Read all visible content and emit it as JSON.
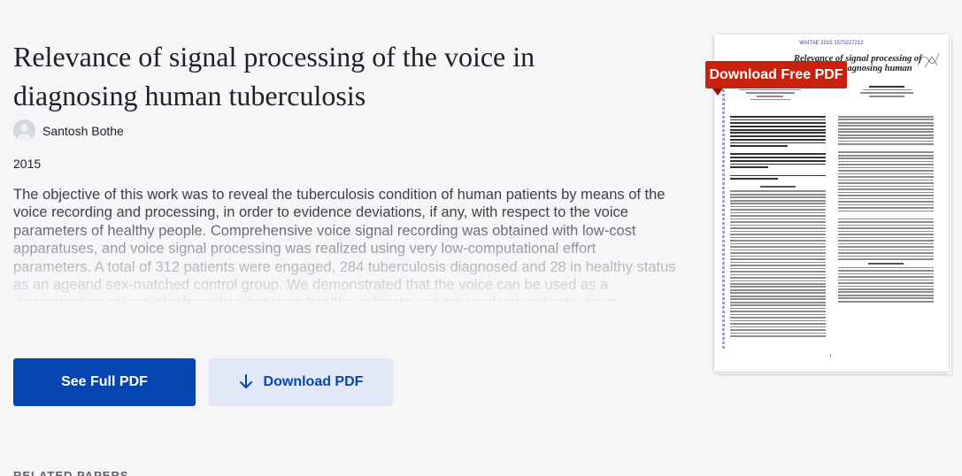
{
  "paper": {
    "title": "Relevance of signal processing of the voice in diagnosing human tuberculosis",
    "author": "Santosh Bothe",
    "year": "2015",
    "abstract": "The objective of this work was to reveal the tuberculosis condition of human patients by means of the voice recording and processing, in order to evidence deviations, if any, with respect to the voice parameters of healthy people. Comprehensive voice signal recording was obtained with low-cost apparatuses, and voice signal processing was realized using very low-computational effort parameters. A total of 312 patients were engaged, 284 tuberculosis diagnosed and 28 in healthy status as an ageand sex-matched control group. We demonstrated that the voice can be used as a discriminating source of information between healthy subjects and tuberculosis patients, since evidence of alterations founded in some of the voice features. Keywords— human voice; voice analysis; voice signal processing; tuberculosis"
  },
  "actions": {
    "see_full_pdf": "See Full PDF",
    "download_pdf": "Download PDF",
    "download_free_pdf": "Download Free PDF"
  },
  "preview": {
    "header": "WAITAE 2015 1570227212",
    "title": "Relevance of signal processing of the voice in diagnosing human tuberculosis",
    "page_number": "1"
  },
  "related_section": {
    "heading": "RELATED PAPERS"
  },
  "colors": {
    "primary": "#0645b1",
    "secondary_bg": "#e2e8f5",
    "badge_red": "#c8210e",
    "page_bg": "#f6f6f9"
  },
  "icons": {
    "download": "download-arrow-icon",
    "avatar": "user-avatar-icon"
  }
}
